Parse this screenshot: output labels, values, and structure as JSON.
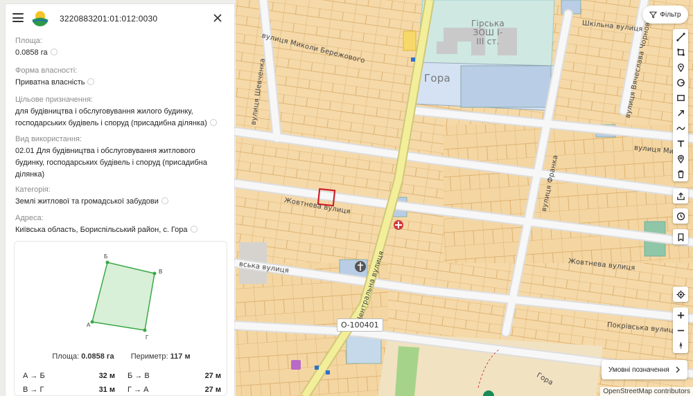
{
  "panel": {
    "cadastral_number": "3220883201:01:012:0030",
    "fields": [
      {
        "label": "Площа:",
        "value": "0.0858 га"
      },
      {
        "label": "Форма власності:",
        "value": "Приватна власність"
      },
      {
        "label": "Цільове призначення:",
        "value": "для будівництва і обслуговування жилого будинку,\nгосподарських будівель і споруд (присадибна ділянка)"
      },
      {
        "label": "Вид використання:",
        "value": "02.01 Для будівництва і обслуговування житлового\nбудинку, господарських будівель і споруд (присадибна\nділянка)"
      },
      {
        "label": "Категорія:",
        "value": "Землі житлової та громадської забудови"
      },
      {
        "label": "Адреса:",
        "value": "Київська область, Бориспільський район, с. Гора"
      }
    ],
    "shape": {
      "vertices": [
        "Б",
        "В",
        "Г",
        "А"
      ],
      "area_label": "Площа:",
      "area_value": "0.0858 га",
      "perimeter_label": "Периметр:",
      "perimeter_value": "117 м",
      "sides": [
        {
          "name": "А → Б",
          "length": "32 м"
        },
        {
          "name": "Б → В",
          "length": "27 м"
        },
        {
          "name": "В → Г",
          "length": "31 м"
        },
        {
          "name": "Г → А",
          "length": "27 м"
        }
      ]
    }
  },
  "map": {
    "labels": {
      "mykoly_berezhovoho": "вулиця Миколи Бережового",
      "shevchenka": "вулиця Шевченка",
      "shkilna": "Шкільна вулиця",
      "viacheslava_chornovola": "вулиця Вячеслава Чорновола",
      "mykoly_right": "вулиця Мико",
      "franka": "вулиця Франка",
      "zhovtneva_left": "Жовтнева вулиця",
      "zhovtneva_right": "Жовтнева вулиця",
      "pokrovska_left": "вська вулиця",
      "pokrovska_right": "Покрівська вулиця",
      "tsentralna": "Центральна вулиця",
      "gora_small": "Гора",
      "village": "Гора",
      "school": "Гірська\nЗОШ І-\nІІІ ст."
    },
    "road_badge": "О-100401",
    "attribution": "OpenStreetMap contributors"
  },
  "controls": {
    "filter_label": "Фільтр",
    "legend_label": "Умовні позначення",
    "tool_icons": [
      "line-measure-icon",
      "polygon-measure-icon",
      "marker-icon",
      "circle-icon",
      "rectangle-icon",
      "arrow-icon",
      "freehand-icon",
      "text-icon",
      "location-pin-icon",
      "trash-icon",
      "share-icon",
      "history-icon",
      "bookmark-icon",
      "my-location-icon",
      "zoom-in-icon",
      "zoom-out-icon",
      "compass-icon"
    ]
  },
  "colors": {
    "parcel_fill": "#f5d9a8",
    "parcel_stroke": "#d9a864",
    "road_main": "#f2ee9a",
    "selected_parcel": "#cc1f2a",
    "school_fill": "#cfe8e2",
    "building_blue": "#b9cde6",
    "shape_fill": "#d8efd8",
    "shape_stroke": "#3aa844"
  }
}
